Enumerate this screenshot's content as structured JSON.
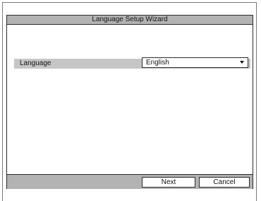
{
  "dialog": {
    "title": "Language Setup Wizard"
  },
  "language": {
    "label": "Language",
    "selected": "English"
  },
  "buttons": {
    "next": "Next",
    "cancel": "Cancel"
  },
  "icons": {
    "dropdown": "chevron-down-icon"
  },
  "colors": {
    "bar": "#b3b3b3",
    "row": "#c6c6c6",
    "border": "#2a2a2a",
    "background": "#ffffff"
  }
}
